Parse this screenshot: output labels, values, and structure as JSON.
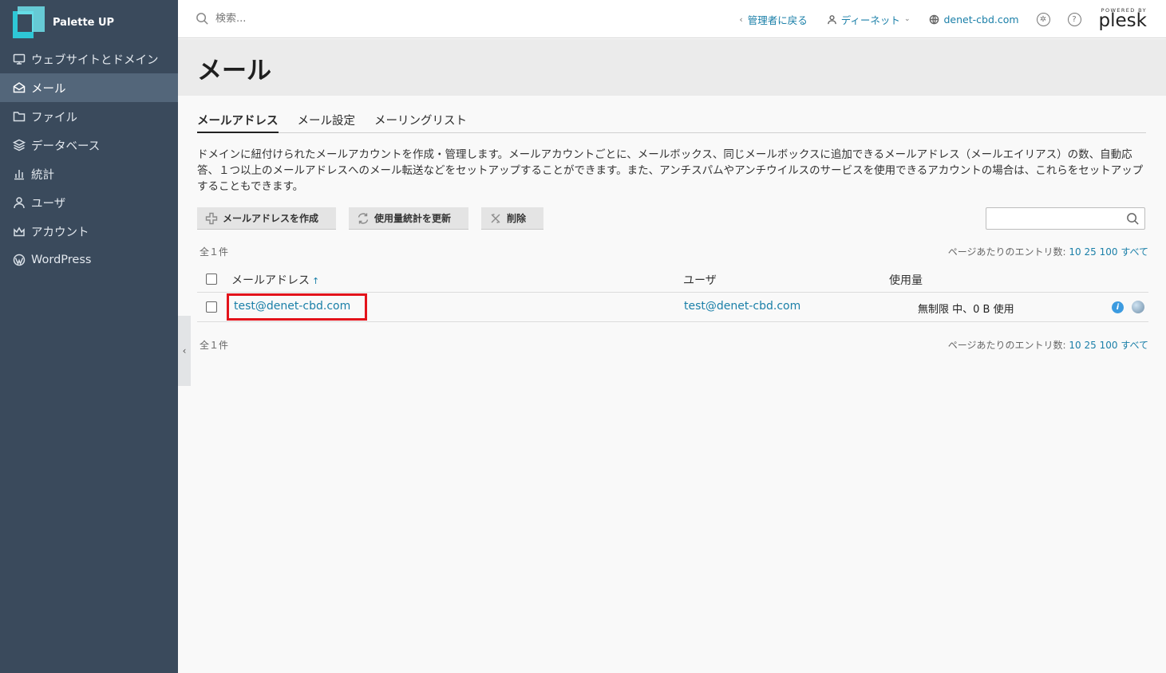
{
  "brand": {
    "name": "Palette UP"
  },
  "sidebar": {
    "items": [
      {
        "label": "ウェブサイトとドメイン",
        "icon": "monitor-icon",
        "active": false
      },
      {
        "label": "メール",
        "icon": "mail-icon",
        "active": true
      },
      {
        "label": "ファイル",
        "icon": "folder-icon",
        "active": false
      },
      {
        "label": "データベース",
        "icon": "layers-icon",
        "active": false
      },
      {
        "label": "統計",
        "icon": "bar-chart-icon",
        "active": false
      },
      {
        "label": "ユーザ",
        "icon": "user-icon",
        "active": false
      },
      {
        "label": "アカウント",
        "icon": "crown-icon",
        "active": false
      },
      {
        "label": "WordPress",
        "icon": "wordpress-icon",
        "active": false
      }
    ]
  },
  "topbar": {
    "search_placeholder": "検索...",
    "back_label": "管理者に戻る",
    "user_label": "ディーネット",
    "domain_label": "denet-cbd.com",
    "powered_by": "POWERED BY",
    "plesk": "plesk"
  },
  "page": {
    "title": "メール"
  },
  "tabs": [
    {
      "label": "メールアドレス",
      "active": true
    },
    {
      "label": "メール設定",
      "active": false
    },
    {
      "label": "メーリングリスト",
      "active": false
    }
  ],
  "description": "ドメインに紐付けられたメールアカウントを作成・管理します。メールアカウントごとに、メールボックス、同じメールボックスに追加できるメールアドレス（メールエイリアス）の数、自動応答、１つ以上のメールアドレスへのメール転送などをセットアップすることができます。また、アンチスパムやアンチウイルスのサービスを使用できるアカウントの場合は、これらをセットアップすることもできます。",
  "toolbar": {
    "create_label": "メールアドレスを作成",
    "refresh_label": "使用量統計を更新",
    "delete_label": "削除"
  },
  "list": {
    "total_label": "全１件",
    "per_page_label": "ページあたりのエントリ数:",
    "per_page_options": [
      "10",
      "25",
      "100",
      "すべて"
    ],
    "columns": {
      "email": "メールアドレス",
      "user": "ユーザ",
      "usage": "使用量"
    },
    "rows": [
      {
        "email": "test@denet-cbd.com",
        "user": "test@denet-cbd.com",
        "usage": "無制限 中、0 B 使用"
      }
    ]
  },
  "colors": {
    "sidebar_bg": "#3a4a5c",
    "link": "#1a7fa8",
    "highlight": "#e3131b"
  }
}
